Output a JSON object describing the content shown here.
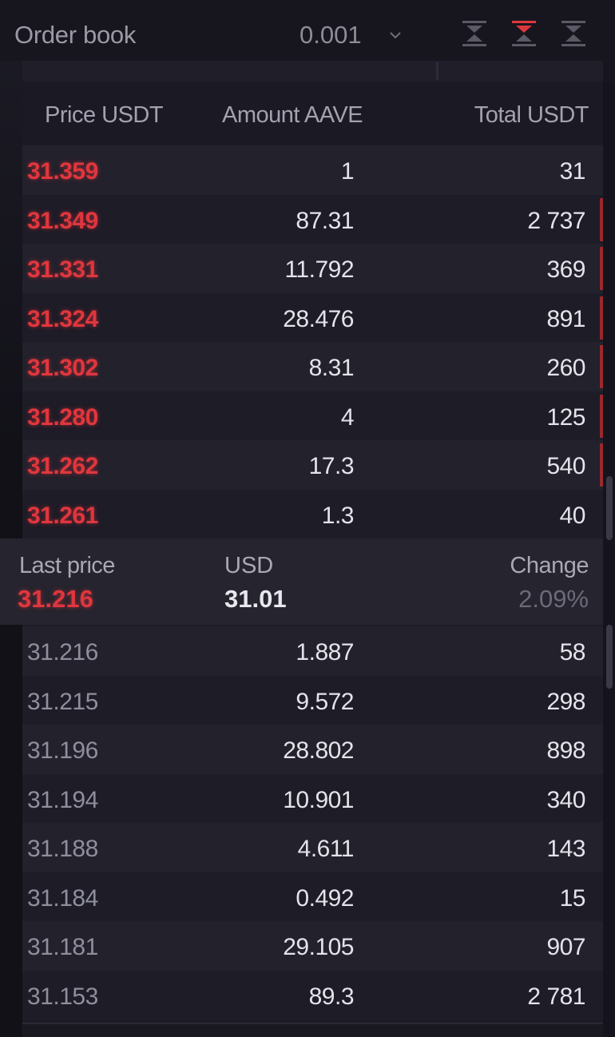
{
  "header": {
    "title": "Order book",
    "precision": "0.001",
    "icons": [
      "chevron-down-icon",
      "view-both-icon",
      "view-asks-icon",
      "view-bids-icon"
    ],
    "active_view_color": "#e0363d"
  },
  "columns": {
    "price": "Price USDT",
    "amount": "Amount AAVE",
    "total": "Total USDT"
  },
  "asks": [
    {
      "price": "31.359",
      "amount": "1",
      "total": "31"
    },
    {
      "price": "31.349",
      "amount": "87.31",
      "total": "2 737"
    },
    {
      "price": "31.331",
      "amount": "11.792",
      "total": "369"
    },
    {
      "price": "31.324",
      "amount": "28.476",
      "total": "891"
    },
    {
      "price": "31.302",
      "amount": "8.31",
      "total": "260"
    },
    {
      "price": "31.280",
      "amount": "4",
      "total": "125"
    },
    {
      "price": "31.262",
      "amount": "17.3",
      "total": "540"
    },
    {
      "price": "31.261",
      "amount": "1.3",
      "total": "40"
    }
  ],
  "last_price": {
    "label": "Last price",
    "value": "31.216",
    "usd_label": "USD",
    "usd_value": "31.01",
    "change_label": "Change",
    "change_value": "2.09%"
  },
  "bids": [
    {
      "price": "31.216",
      "amount": "1.887",
      "total": "58"
    },
    {
      "price": "31.215",
      "amount": "9.572",
      "total": "298"
    },
    {
      "price": "31.196",
      "amount": "28.802",
      "total": "898"
    },
    {
      "price": "31.194",
      "amount": "10.901",
      "total": "340"
    },
    {
      "price": "31.188",
      "amount": "4.611",
      "total": "143"
    },
    {
      "price": "31.184",
      "amount": "0.492",
      "total": "15"
    },
    {
      "price": "31.181",
      "amount": "29.105",
      "total": "907"
    },
    {
      "price": "31.153",
      "amount": "89.3",
      "total": "2 781"
    }
  ],
  "colors": {
    "ask": "#e0363d",
    "bid_price": "#8f8e9c",
    "background": "#1c1b26"
  }
}
